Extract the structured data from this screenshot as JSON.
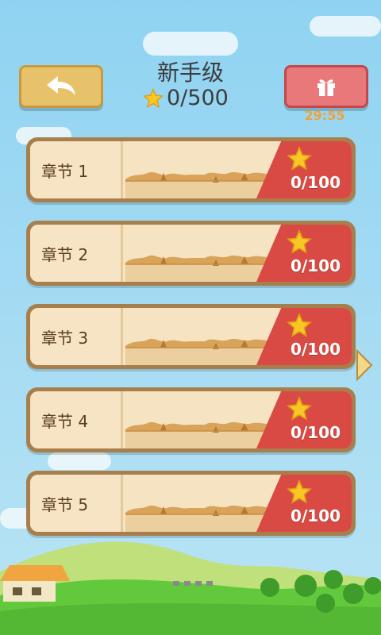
{
  "header": {
    "title": "新手级",
    "stars_total": "0/500",
    "timer": "29:55"
  },
  "chapters": [
    {
      "label": "章节 1",
      "score": "0/100"
    },
    {
      "label": "章节 2",
      "score": "0/100"
    },
    {
      "label": "章节 3",
      "score": "0/100"
    },
    {
      "label": "章节 4",
      "score": "0/100"
    },
    {
      "label": "章节 5",
      "score": "0/100"
    }
  ],
  "colors": {
    "back_button": "#e8c26a",
    "gift_button": "#e8787a",
    "timer": "#f0a33a",
    "card_frame": "#a77f4c",
    "card_red": "#d84a43",
    "star": "#f7c825"
  },
  "icons": {
    "back": "back-arrow-icon",
    "gift": "gift-icon",
    "star": "star-icon",
    "next": "chevron-right-icon"
  }
}
